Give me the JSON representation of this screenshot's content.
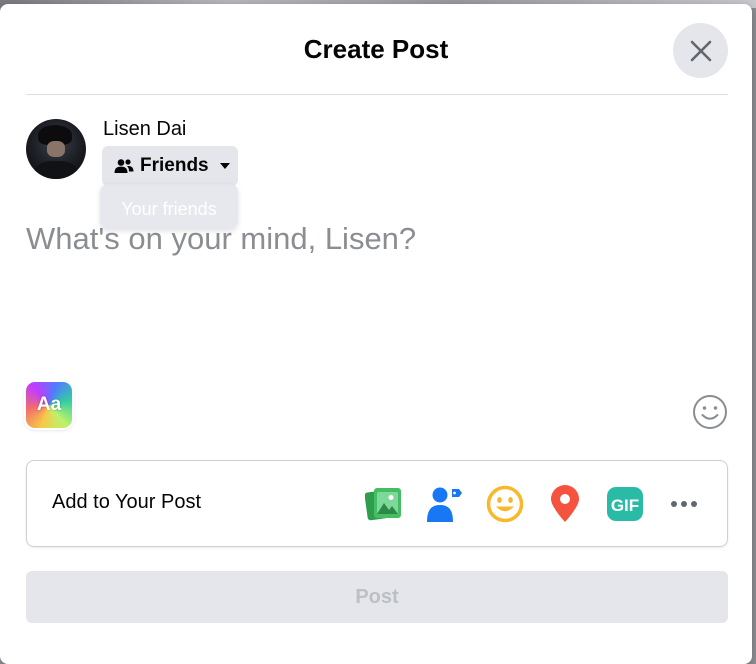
{
  "dialog": {
    "title": "Create Post",
    "close_icon": "close-icon"
  },
  "user": {
    "name": "Lisen Dai",
    "avatar_icon": "avatar"
  },
  "audience": {
    "label": "Friends",
    "icon": "friends-icon",
    "caret_icon": "caret-down-icon",
    "tooltip": "Your friends"
  },
  "composer": {
    "placeholder": "What's on your mind, Lisen?"
  },
  "background_picker": {
    "label": "Aa"
  },
  "add_to_post": {
    "label": "Add to Your Post",
    "items": [
      {
        "name": "photo-video-icon",
        "color": "#45bd62"
      },
      {
        "name": "tag-people-icon",
        "color": "#1877f2"
      },
      {
        "name": "feeling-activity-icon",
        "color": "#f7b928"
      },
      {
        "name": "check-in-icon",
        "color": "#f5533d"
      },
      {
        "name": "gif-icon",
        "color": "#2abba7",
        "label": "GIF"
      },
      {
        "name": "more-icon",
        "color": "#606770"
      }
    ]
  },
  "post_button": {
    "label": "Post"
  },
  "colors": {
    "disabled_bg": "#e4e6eb",
    "disabled_text": "#bcc0c4",
    "placeholder": "#8a8d91"
  }
}
